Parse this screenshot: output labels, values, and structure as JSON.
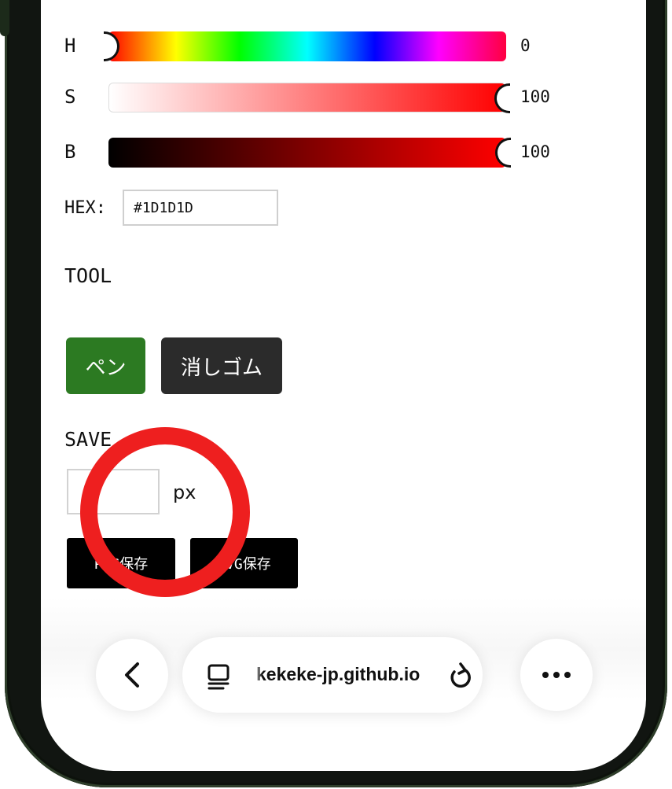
{
  "color_picker": {
    "hue": {
      "label": "H",
      "value": "0"
    },
    "saturation": {
      "label": "S",
      "value": "100"
    },
    "brightness": {
      "label": "B",
      "value": "100"
    },
    "hex": {
      "label": "HEX:",
      "value": "#1D1D1D"
    }
  },
  "tool": {
    "title": "TOOL",
    "pen_label": "ペン",
    "eraser_label": "消しゴム"
  },
  "save": {
    "title": "SAVE",
    "size_value": "",
    "size_unit": "px",
    "png_label": "PNG保存",
    "svg_label": "SVG保存"
  },
  "browser": {
    "url": "kekeke-jp.github.io"
  },
  "colors": {
    "pen_active": "#2c7a22",
    "eraser": "#2b2b2b",
    "highlight": "#ee1f1f"
  }
}
